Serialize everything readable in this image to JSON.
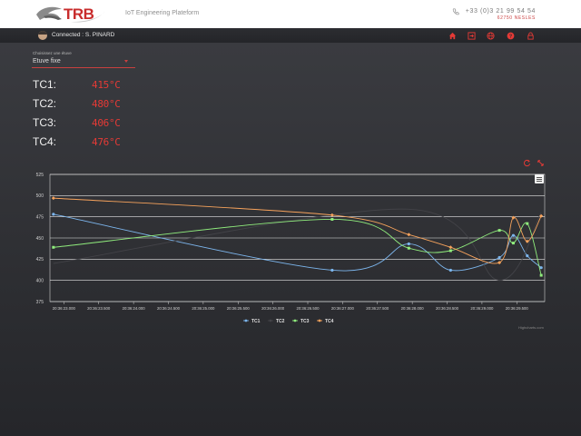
{
  "header": {
    "logo_text": "TRB",
    "tagline": "IoT Engineering Plateform",
    "phone": "+33 (0)3 21 99 54 54",
    "city": "62750 NESLES"
  },
  "navbar": {
    "connected_label": "Connected : S. PINARD",
    "icons": [
      "home-icon",
      "login-icon",
      "globe-icon",
      "help-icon",
      "lock-icon"
    ],
    "icon_color": "#e53a36"
  },
  "selector": {
    "label": "Choisissez une étuve",
    "value": "Etuve fixe"
  },
  "readings": [
    {
      "label": "TC1:",
      "value": "415°C"
    },
    {
      "label": "TC2:",
      "value": "480°C"
    },
    {
      "label": "TC3:",
      "value": "406°C"
    },
    {
      "label": "TC4:",
      "value": "476°C"
    }
  ],
  "chart_data": {
    "type": "line",
    "x_ticks": [
      "20:36:23.000",
      "20:36:23.500",
      "20:36:24.000",
      "20:36:24.500",
      "20:36:25.000",
      "20:36:25.500",
      "20:36:26.000",
      "20:36:26.500",
      "20:36:27.000",
      "20:36:27.500",
      "20:36:28.000",
      "20:36:28.500",
      "20:36:29.000",
      "20:36:29.500"
    ],
    "xlim": [
      "20:36:22.800",
      "20:36:29.900"
    ],
    "y_ticks": [
      375,
      400,
      425,
      450,
      475,
      500,
      525
    ],
    "ylim": [
      375,
      525
    ],
    "grid": "horizontal",
    "legend_position": "bottom",
    "credit": "Highcharts.com",
    "series": [
      {
        "name": "TC1",
        "color": "#7cb5ec",
        "marker": "circle",
        "x": [
          22.85,
          26.85,
          27.95,
          28.55,
          29.25,
          29.45,
          29.65,
          29.85
        ],
        "y": [
          478,
          412,
          443,
          412,
          427,
          453,
          429,
          415
        ]
      },
      {
        "name": "TC2",
        "color": "#434348",
        "marker": "circle",
        "x": [
          22.85,
          27.95,
          29.25,
          29.85
        ],
        "y": [
          420,
          484,
          400,
          480
        ]
      },
      {
        "name": "TC3",
        "color": "#90ed7d",
        "marker": "square",
        "x": [
          22.85,
          26.85,
          27.95,
          28.55,
          29.25,
          29.45,
          29.65,
          29.85
        ],
        "y": [
          439,
          472,
          438,
          435,
          459,
          444,
          467,
          406
        ]
      },
      {
        "name": "TC4",
        "color": "#f7a35c",
        "marker": "diamond",
        "x": [
          22.85,
          26.85,
          27.95,
          28.55,
          29.25,
          29.45,
          29.65,
          29.85
        ],
        "y": [
          497,
          477,
          454,
          439,
          421,
          474,
          446,
          476
        ]
      }
    ]
  }
}
